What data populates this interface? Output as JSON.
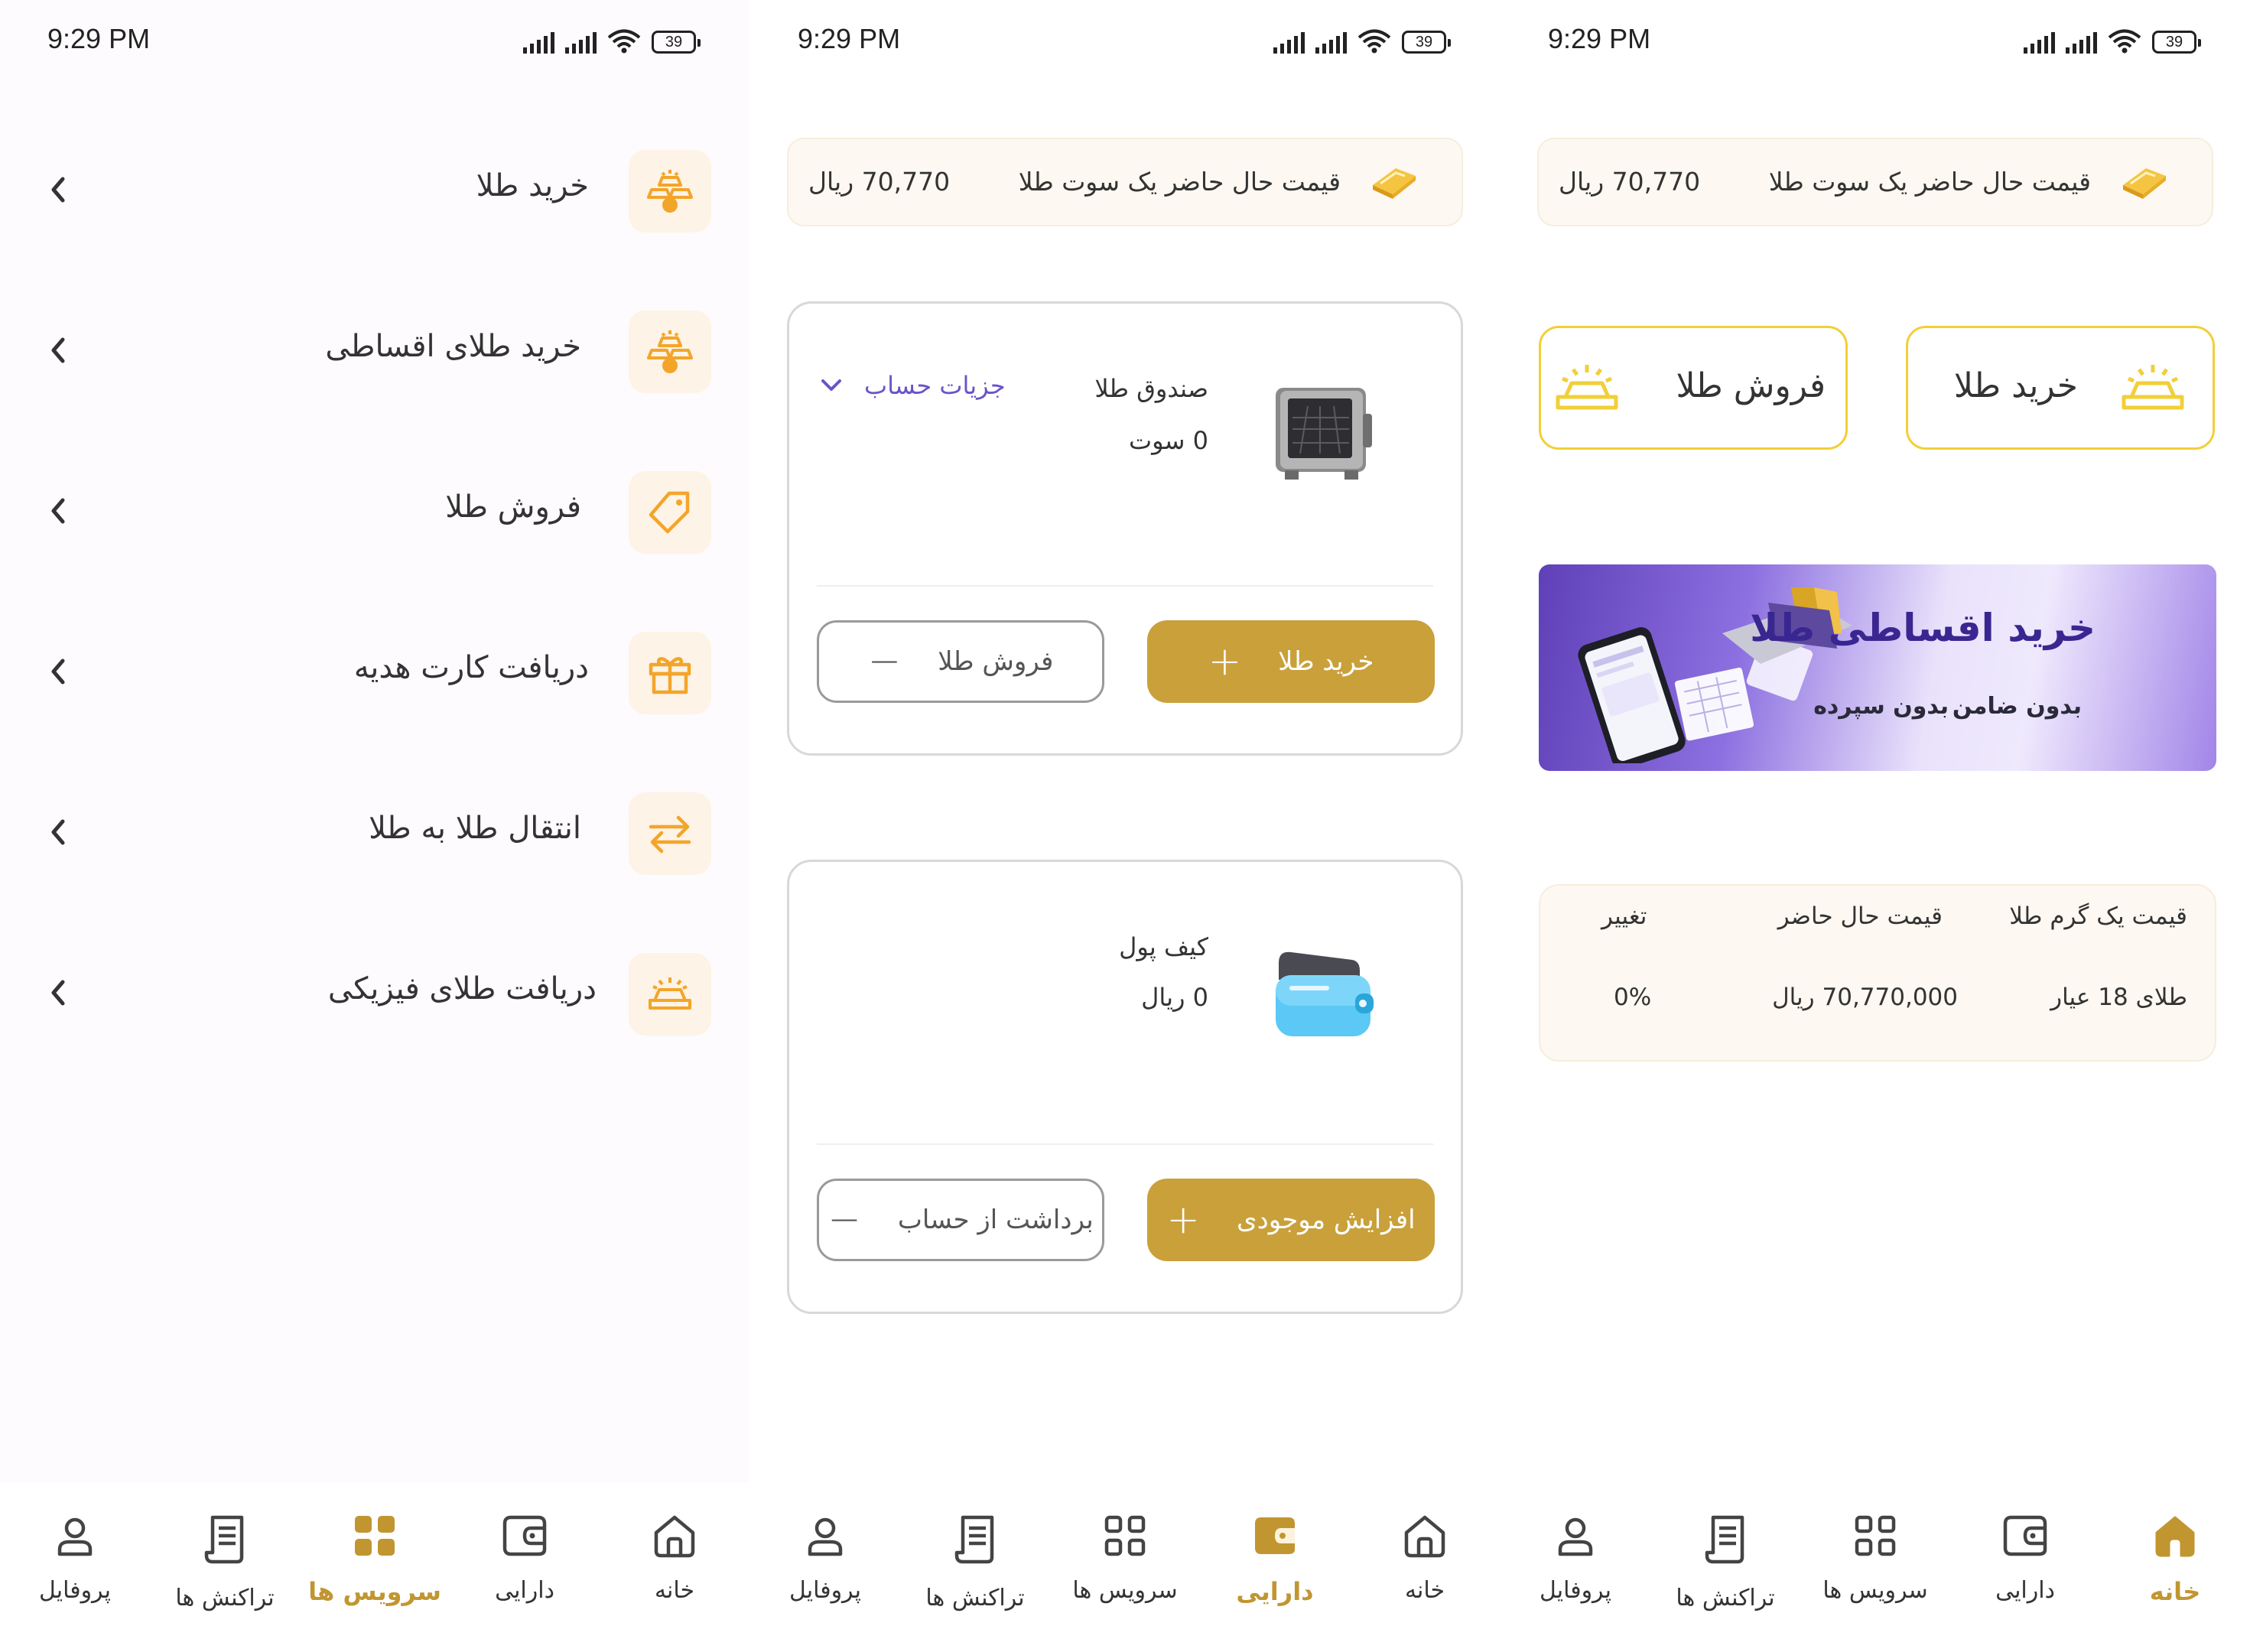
{
  "status": {
    "time": "9:29 PM",
    "battery": "39"
  },
  "nav": {
    "home": "خانه",
    "assets": "دارایی",
    "services": "سرویس ها",
    "transactions": "تراکنش ها",
    "profile": "پروفایل"
  },
  "colors": {
    "gold": "#c9a03a",
    "gold_active": "#c19631",
    "accent_purple": "#6b54c8",
    "yellow_border": "#f2cf37",
    "icon_orange": "#f3a52a"
  },
  "services": {
    "items": [
      {
        "label": "خرید طلا",
        "icon": "gold-bars-icon"
      },
      {
        "label": "خرید طلای اقساطی",
        "icon": "gold-bars-icon"
      },
      {
        "label": "فروش طلا",
        "icon": "price-tag-icon"
      },
      {
        "label": "دریافت کارت هدیه",
        "icon": "gift-icon"
      },
      {
        "label": "انتقال طلا به طلا",
        "icon": "swap-arrows-icon"
      },
      {
        "label": "دریافت طلای فیزیکی",
        "icon": "gold-bar-icon"
      }
    ]
  },
  "price_banner": {
    "label": "قیمت حال حاضر یک سوت طلا",
    "value": "70,770 ریال"
  },
  "assets": {
    "gold_box": {
      "title": "صندوق طلا",
      "amount": "0 سوت",
      "details": "جزیات حساب",
      "buy": "خرید طلا",
      "sell": "فروش طلا"
    },
    "wallet": {
      "title": "کیف پول",
      "amount": "0 ریال",
      "deposit": "افزایش موجودی",
      "withdraw": "برداشت از حساب"
    }
  },
  "home": {
    "buy_gold": "خرید طلا",
    "sell_gold": "فروش طلا",
    "promo": {
      "title": "خرید اقساطی طلا",
      "tag1": "بدون ضامن",
      "tag2": "بدون سپرده"
    },
    "rate_table": {
      "headers": [
        "قیمت یک گرم طلا",
        "قیمت حال حاضر",
        "تغییر"
      ],
      "row": [
        "طلای 18 عیار",
        "70,770,000 ریال",
        "0%"
      ]
    }
  }
}
